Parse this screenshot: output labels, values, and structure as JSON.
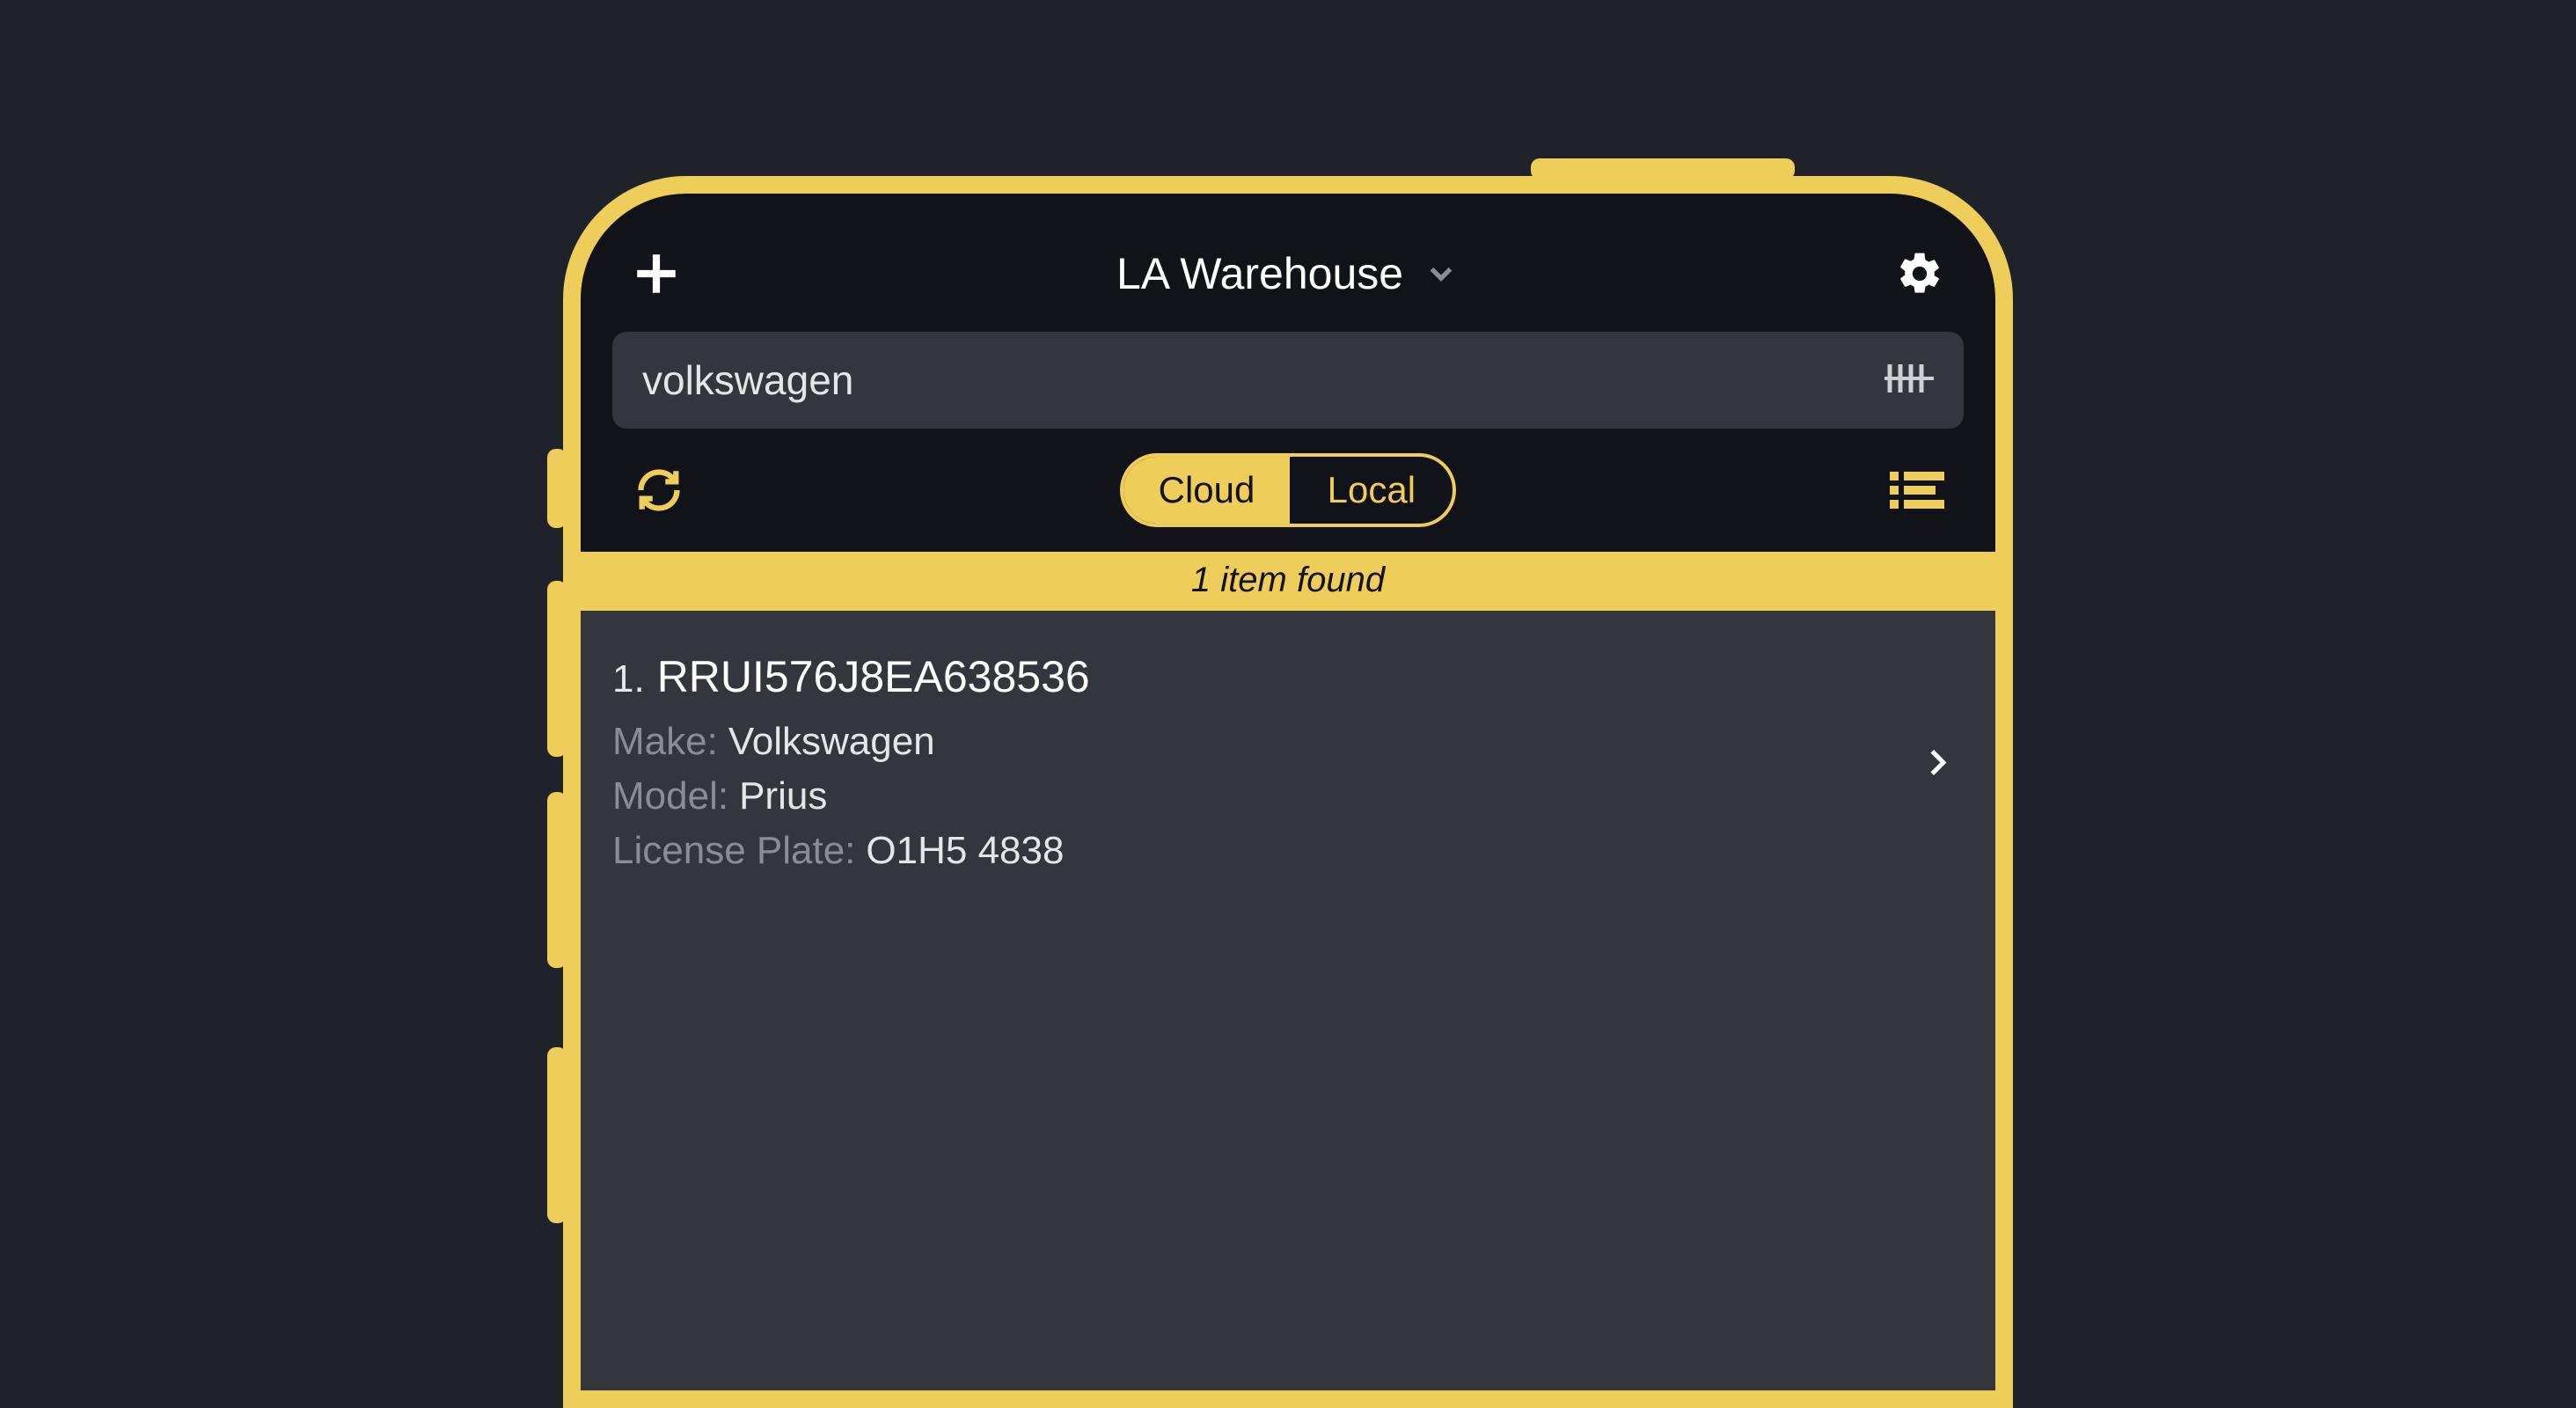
{
  "colors": {
    "accent": "#efcd5a",
    "bg": "#1f2228",
    "panel": "#121319",
    "field": "#34363d"
  },
  "header": {
    "title": "LA Warehouse"
  },
  "search": {
    "value": "volkswagen"
  },
  "segmented": {
    "cloud": "Cloud",
    "local": "Local"
  },
  "status": {
    "text": "1 item found"
  },
  "results": [
    {
      "index": "1.",
      "id": "RRUI576J8EA638536",
      "make_label": "Make:",
      "make_value": "Volkswagen",
      "model_label": "Model:",
      "model_value": "Prius",
      "plate_label": "License Plate:",
      "plate_value": "O1H5 4838"
    }
  ]
}
